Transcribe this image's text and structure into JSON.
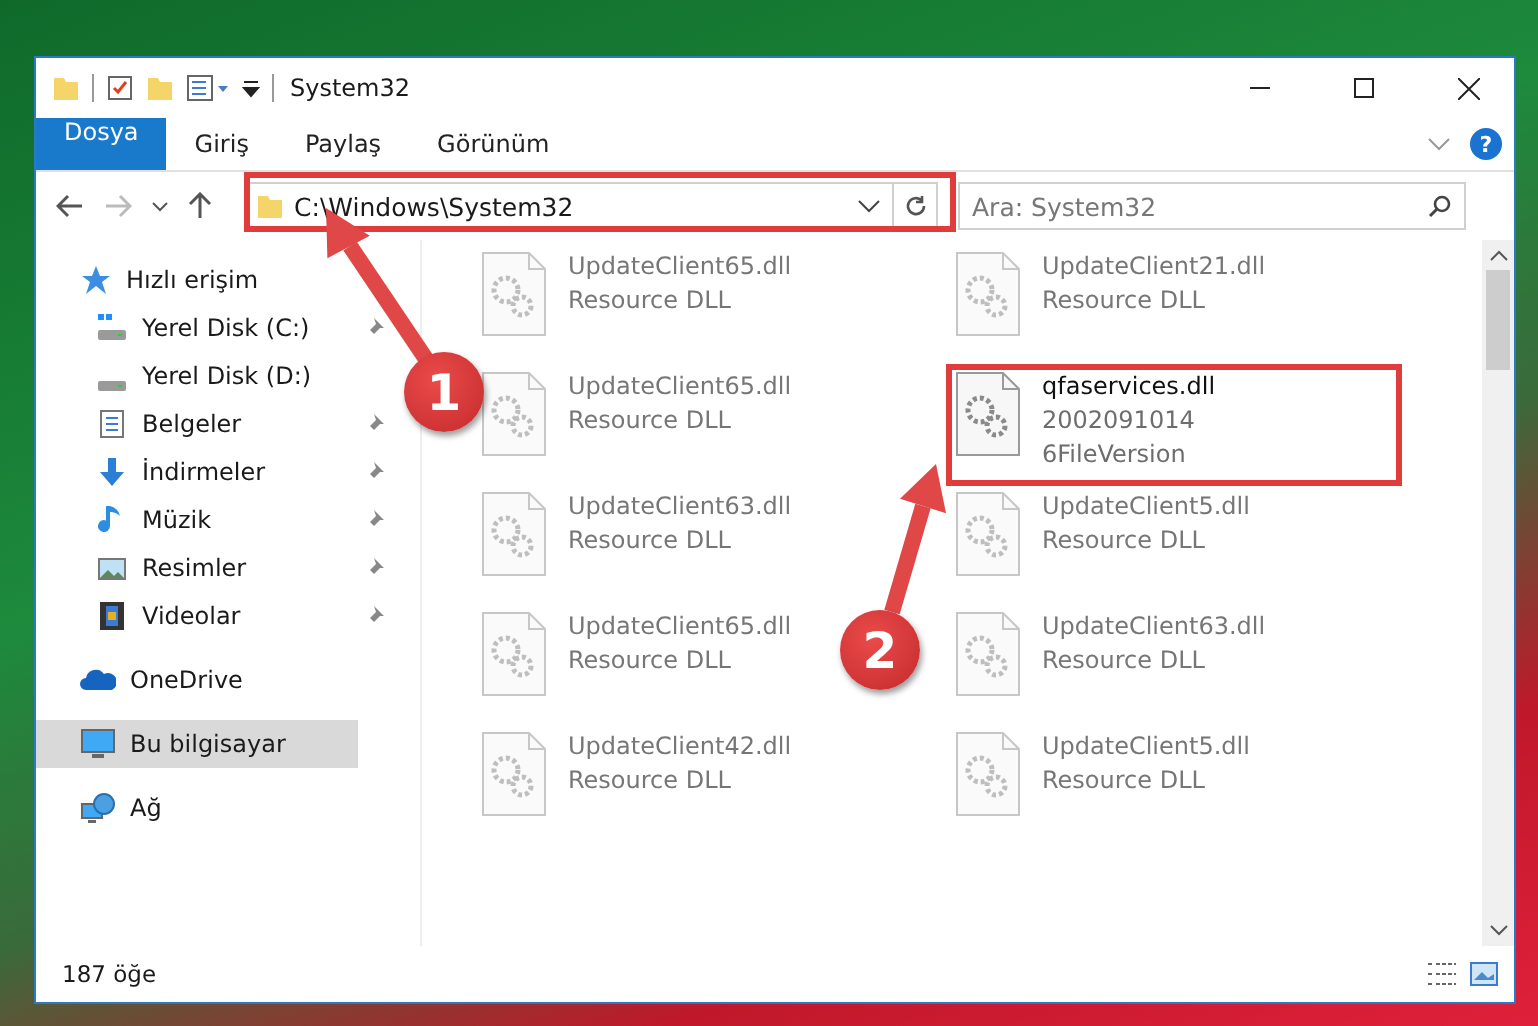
{
  "window": {
    "title": "System32"
  },
  "ribbon_tabs": [
    {
      "label": "Dosya",
      "kind": "file"
    },
    {
      "label": "Giriş",
      "kind": "tab"
    },
    {
      "label": "Paylaş",
      "kind": "tab"
    },
    {
      "label": "Görünüm",
      "kind": "tab"
    }
  ],
  "help": {
    "label": "?"
  },
  "address": {
    "path": "C:\\Windows\\System32"
  },
  "search": {
    "placeholder": "Ara: System32"
  },
  "nav": [
    {
      "label": "Hızlı erişim",
      "kind": "quick-access",
      "selected": false,
      "children": [
        {
          "label": "Yerel Disk (C:)",
          "kind": "system-disk",
          "pinned": true,
          "selected": false
        },
        {
          "label": "Yerel Disk (D:)",
          "kind": "disk",
          "pinned": false,
          "selected": false
        },
        {
          "label": "Belgeler",
          "kind": "documents",
          "pinned": true,
          "selected": false
        },
        {
          "label": "İndirmeler",
          "kind": "downloads",
          "pinned": true,
          "selected": false
        },
        {
          "label": "Müzik",
          "kind": "music",
          "pinned": true,
          "selected": false
        },
        {
          "label": "Resimler",
          "kind": "pictures",
          "pinned": true,
          "selected": false
        },
        {
          "label": "Videolar",
          "kind": "videos",
          "pinned": true,
          "selected": false
        }
      ]
    },
    {
      "label": "OneDrive",
      "kind": "onedrive",
      "selected": false
    },
    {
      "label": "Bu bilgisayar",
      "kind": "computer",
      "selected": true
    },
    {
      "label": "Ağ",
      "kind": "network",
      "selected": false
    }
  ],
  "files": [
    {
      "name": "UpdateClient65.dll",
      "details": [
        "Resource DLL"
      ],
      "blurred": true
    },
    {
      "name": "UpdateClient21.dll",
      "details": [
        "Resource DLL"
      ],
      "blurred": true
    },
    {
      "name": "UpdateClient65.dll",
      "details": [
        "Resource DLL"
      ],
      "blurred": true
    },
    {
      "name": "qfaservices.dll",
      "details": [
        "2002091014",
        "6FileVersion"
      ],
      "blurred": false
    },
    {
      "name": "UpdateClient63.dll",
      "details": [
        "Resource DLL"
      ],
      "blurred": true
    },
    {
      "name": "UpdateClient5.dll",
      "details": [
        "Resource DLL"
      ],
      "blurred": true
    },
    {
      "name": "UpdateClient65.dll",
      "details": [
        "Resource DLL"
      ],
      "blurred": true
    },
    {
      "name": "UpdateClient63.dll",
      "details": [
        "Resource DLL"
      ],
      "blurred": true
    },
    {
      "name": "UpdateClient42.dll",
      "details": [
        "Resource DLL"
      ],
      "blurred": true
    },
    {
      "name": "UpdateClient5.dll",
      "details": [
        "Resource DLL"
      ],
      "blurred": true
    }
  ],
  "status_bar": {
    "item_count": "187 öğe"
  },
  "annotations": [
    {
      "label": "1"
    },
    {
      "label": "2"
    }
  ]
}
